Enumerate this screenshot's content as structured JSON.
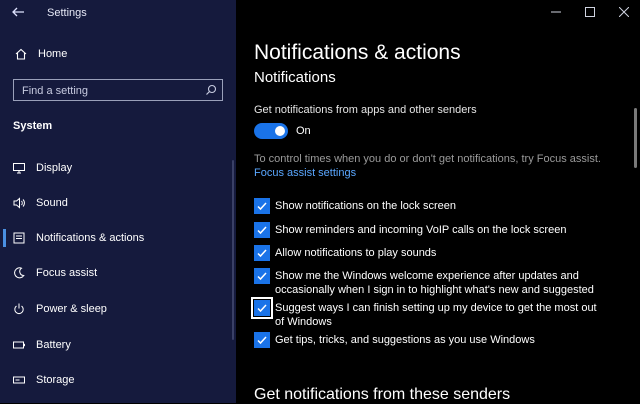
{
  "window": {
    "title": "Settings"
  },
  "sidebar": {
    "home_label": "Home",
    "search_placeholder": "Find a setting",
    "section_label": "System",
    "items": [
      {
        "label": "Display",
        "icon": "monitor-icon"
      },
      {
        "label": "Sound",
        "icon": "speaker-icon"
      },
      {
        "label": "Notifications & actions",
        "icon": "notifications-icon"
      },
      {
        "label": "Focus assist",
        "icon": "moon-icon"
      },
      {
        "label": "Power & sleep",
        "icon": "power-icon"
      },
      {
        "label": "Battery",
        "icon": "battery-icon"
      },
      {
        "label": "Storage",
        "icon": "storage-icon"
      }
    ]
  },
  "main": {
    "title": "Notifications & actions",
    "section_title": "Notifications",
    "toggle_caption": "Get notifications from apps and other senders",
    "toggle_state": "On",
    "hint": "To control times when you do or don't get notifications, try Focus assist.",
    "link": "Focus assist settings",
    "checkboxes": [
      {
        "label": "Show notifications on the lock screen",
        "checked": true
      },
      {
        "label": "Show reminders and incoming VoIP calls on the lock screen",
        "checked": true
      },
      {
        "label": "Allow notifications to play sounds",
        "checked": true
      },
      {
        "label": "Show me the Windows welcome experience after updates and occasionally when I sign in to highlight what's new and suggested",
        "checked": true
      },
      {
        "label": "Suggest ways I can finish setting up my device to get the most out of Windows",
        "checked": true
      },
      {
        "label": "Get tips, tricks, and suggestions as you use Windows",
        "checked": true
      }
    ],
    "senders_heading": "Get notifications from these senders"
  },
  "colors": {
    "sidebar_bg": "#151a3d",
    "accent": "#1a73e8",
    "link": "#5aa7ff"
  }
}
